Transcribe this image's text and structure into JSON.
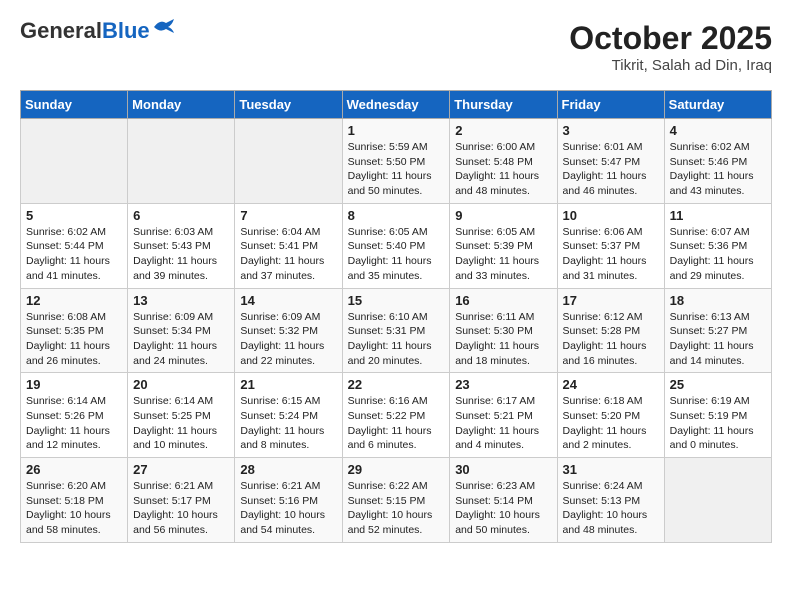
{
  "header": {
    "logo_general": "General",
    "logo_blue": "Blue",
    "title": "October 2025",
    "subtitle": "Tikrit, Salah ad Din, Iraq"
  },
  "days_of_week": [
    "Sunday",
    "Monday",
    "Tuesday",
    "Wednesday",
    "Thursday",
    "Friday",
    "Saturday"
  ],
  "weeks": [
    [
      {
        "day": "",
        "info": ""
      },
      {
        "day": "",
        "info": ""
      },
      {
        "day": "",
        "info": ""
      },
      {
        "day": "1",
        "info": "Sunrise: 5:59 AM\nSunset: 5:50 PM\nDaylight: 11 hours\nand 50 minutes."
      },
      {
        "day": "2",
        "info": "Sunrise: 6:00 AM\nSunset: 5:48 PM\nDaylight: 11 hours\nand 48 minutes."
      },
      {
        "day": "3",
        "info": "Sunrise: 6:01 AM\nSunset: 5:47 PM\nDaylight: 11 hours\nand 46 minutes."
      },
      {
        "day": "4",
        "info": "Sunrise: 6:02 AM\nSunset: 5:46 PM\nDaylight: 11 hours\nand 43 minutes."
      }
    ],
    [
      {
        "day": "5",
        "info": "Sunrise: 6:02 AM\nSunset: 5:44 PM\nDaylight: 11 hours\nand 41 minutes."
      },
      {
        "day": "6",
        "info": "Sunrise: 6:03 AM\nSunset: 5:43 PM\nDaylight: 11 hours\nand 39 minutes."
      },
      {
        "day": "7",
        "info": "Sunrise: 6:04 AM\nSunset: 5:41 PM\nDaylight: 11 hours\nand 37 minutes."
      },
      {
        "day": "8",
        "info": "Sunrise: 6:05 AM\nSunset: 5:40 PM\nDaylight: 11 hours\nand 35 minutes."
      },
      {
        "day": "9",
        "info": "Sunrise: 6:05 AM\nSunset: 5:39 PM\nDaylight: 11 hours\nand 33 minutes."
      },
      {
        "day": "10",
        "info": "Sunrise: 6:06 AM\nSunset: 5:37 PM\nDaylight: 11 hours\nand 31 minutes."
      },
      {
        "day": "11",
        "info": "Sunrise: 6:07 AM\nSunset: 5:36 PM\nDaylight: 11 hours\nand 29 minutes."
      }
    ],
    [
      {
        "day": "12",
        "info": "Sunrise: 6:08 AM\nSunset: 5:35 PM\nDaylight: 11 hours\nand 26 minutes."
      },
      {
        "day": "13",
        "info": "Sunrise: 6:09 AM\nSunset: 5:34 PM\nDaylight: 11 hours\nand 24 minutes."
      },
      {
        "day": "14",
        "info": "Sunrise: 6:09 AM\nSunset: 5:32 PM\nDaylight: 11 hours\nand 22 minutes."
      },
      {
        "day": "15",
        "info": "Sunrise: 6:10 AM\nSunset: 5:31 PM\nDaylight: 11 hours\nand 20 minutes."
      },
      {
        "day": "16",
        "info": "Sunrise: 6:11 AM\nSunset: 5:30 PM\nDaylight: 11 hours\nand 18 minutes."
      },
      {
        "day": "17",
        "info": "Sunrise: 6:12 AM\nSunset: 5:28 PM\nDaylight: 11 hours\nand 16 minutes."
      },
      {
        "day": "18",
        "info": "Sunrise: 6:13 AM\nSunset: 5:27 PM\nDaylight: 11 hours\nand 14 minutes."
      }
    ],
    [
      {
        "day": "19",
        "info": "Sunrise: 6:14 AM\nSunset: 5:26 PM\nDaylight: 11 hours\nand 12 minutes."
      },
      {
        "day": "20",
        "info": "Sunrise: 6:14 AM\nSunset: 5:25 PM\nDaylight: 11 hours\nand 10 minutes."
      },
      {
        "day": "21",
        "info": "Sunrise: 6:15 AM\nSunset: 5:24 PM\nDaylight: 11 hours\nand 8 minutes."
      },
      {
        "day": "22",
        "info": "Sunrise: 6:16 AM\nSunset: 5:22 PM\nDaylight: 11 hours\nand 6 minutes."
      },
      {
        "day": "23",
        "info": "Sunrise: 6:17 AM\nSunset: 5:21 PM\nDaylight: 11 hours\nand 4 minutes."
      },
      {
        "day": "24",
        "info": "Sunrise: 6:18 AM\nSunset: 5:20 PM\nDaylight: 11 hours\nand 2 minutes."
      },
      {
        "day": "25",
        "info": "Sunrise: 6:19 AM\nSunset: 5:19 PM\nDaylight: 11 hours\nand 0 minutes."
      }
    ],
    [
      {
        "day": "26",
        "info": "Sunrise: 6:20 AM\nSunset: 5:18 PM\nDaylight: 10 hours\nand 58 minutes."
      },
      {
        "day": "27",
        "info": "Sunrise: 6:21 AM\nSunset: 5:17 PM\nDaylight: 10 hours\nand 56 minutes."
      },
      {
        "day": "28",
        "info": "Sunrise: 6:21 AM\nSunset: 5:16 PM\nDaylight: 10 hours\nand 54 minutes."
      },
      {
        "day": "29",
        "info": "Sunrise: 6:22 AM\nSunset: 5:15 PM\nDaylight: 10 hours\nand 52 minutes."
      },
      {
        "day": "30",
        "info": "Sunrise: 6:23 AM\nSunset: 5:14 PM\nDaylight: 10 hours\nand 50 minutes."
      },
      {
        "day": "31",
        "info": "Sunrise: 6:24 AM\nSunset: 5:13 PM\nDaylight: 10 hours\nand 48 minutes."
      },
      {
        "day": "",
        "info": ""
      }
    ]
  ]
}
